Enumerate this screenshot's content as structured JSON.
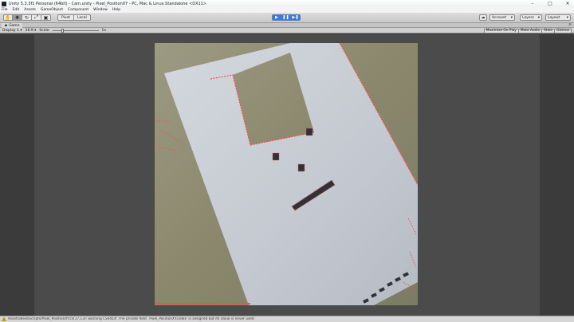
{
  "window": {
    "title": "Unity 5.3.3f1 Personal (64bit) - Cam.unity - Pixel_PositionXY - PC, Mac & Linux Standalone <DX11>",
    "controls": [
      "–",
      "□",
      "✕"
    ]
  },
  "menu": [
    "File",
    "Edit",
    "Assets",
    "GameObject",
    "Component",
    "Window",
    "Help"
  ],
  "toolbar": {
    "pivot": "Pivot",
    "local": "Local",
    "account": "Account",
    "layers": "Layers",
    "layout": "Layout"
  },
  "game_tab": {
    "label": "Game"
  },
  "game_controls": {
    "display": "Display 1",
    "aspect": "16:9",
    "scale_label": "Scale",
    "scale_value": "1x",
    "scale_fraction": 0.2,
    "toggles": [
      "Maximize On Play",
      "Mute Audio",
      "Stats",
      "Gizmos"
    ]
  },
  "status": {
    "message": "Assets/Bedi/Scripts/Pixel_PositionXY.cs(17,13): warning CS0414: The private field `Pixel_PositionXY.index' is assigned but its value is never used"
  },
  "colors": {
    "accent": "#3c78d8",
    "detect": "#ff4a4a",
    "paper": "#c9ced6",
    "background_wall": "#8f8e71"
  },
  "icons": {
    "hand_tool": "hand-icon",
    "move_tool": "move-icon",
    "rotate_tool": "rotate-icon",
    "scale_tool": "scale-icon",
    "rect_tool": "rect-icon",
    "play": "play-icon",
    "pause": "pause-icon",
    "step": "step-icon",
    "cloud": "cloud-icon",
    "warning": "warning-icon"
  }
}
